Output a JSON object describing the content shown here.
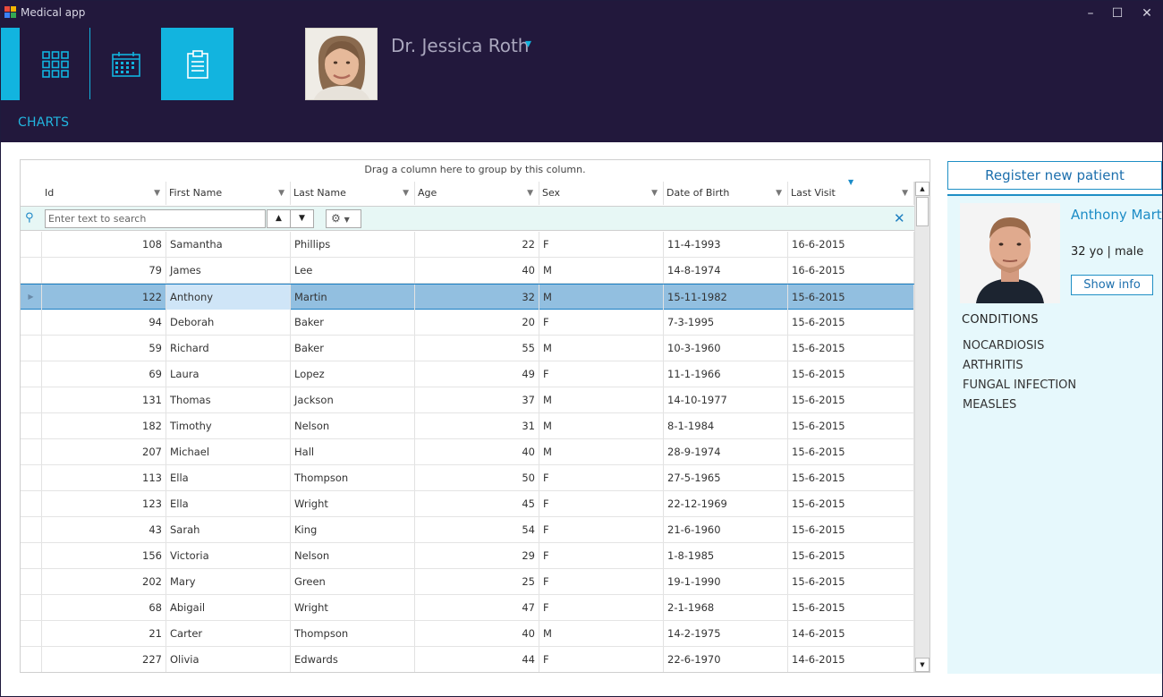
{
  "window": {
    "title": "Medical app"
  },
  "nav": {
    "section_label": "CHARTS",
    "doctor_name": "Dr. Jessica Roth"
  },
  "grid": {
    "group_panel_text": "Drag a column here to group by this column.",
    "columns": [
      "Id",
      "First Name",
      "Last Name",
      "Age",
      "Sex",
      "Date of Birth",
      "Last Visit"
    ],
    "search_placeholder": "Enter text to search",
    "rows": [
      {
        "id": "108",
        "first": "Samantha",
        "last": "Phillips",
        "age": "22",
        "sex": "F",
        "dob": "11-4-1993",
        "visit": "16-6-2015"
      },
      {
        "id": "79",
        "first": "James",
        "last": "Lee",
        "age": "40",
        "sex": "M",
        "dob": "14-8-1974",
        "visit": "16-6-2015"
      },
      {
        "id": "122",
        "first": "Anthony",
        "last": "Martin",
        "age": "32",
        "sex": "M",
        "dob": "15-11-1982",
        "visit": "15-6-2015"
      },
      {
        "id": "94",
        "first": "Deborah",
        "last": "Baker",
        "age": "20",
        "sex": "F",
        "dob": "7-3-1995",
        "visit": "15-6-2015"
      },
      {
        "id": "59",
        "first": "Richard",
        "last": "Baker",
        "age": "55",
        "sex": "M",
        "dob": "10-3-1960",
        "visit": "15-6-2015"
      },
      {
        "id": "69",
        "first": "Laura",
        "last": "Lopez",
        "age": "49",
        "sex": "F",
        "dob": "11-1-1966",
        "visit": "15-6-2015"
      },
      {
        "id": "131",
        "first": "Thomas",
        "last": "Jackson",
        "age": "37",
        "sex": "M",
        "dob": "14-10-1977",
        "visit": "15-6-2015"
      },
      {
        "id": "182",
        "first": "Timothy",
        "last": "Nelson",
        "age": "31",
        "sex": "M",
        "dob": "8-1-1984",
        "visit": "15-6-2015"
      },
      {
        "id": "207",
        "first": "Michael",
        "last": "Hall",
        "age": "40",
        "sex": "M",
        "dob": "28-9-1974",
        "visit": "15-6-2015"
      },
      {
        "id": "113",
        "first": "Ella",
        "last": "Thompson",
        "age": "50",
        "sex": "F",
        "dob": "27-5-1965",
        "visit": "15-6-2015"
      },
      {
        "id": "123",
        "first": "Ella",
        "last": "Wright",
        "age": "45",
        "sex": "F",
        "dob": "22-12-1969",
        "visit": "15-6-2015"
      },
      {
        "id": "43",
        "first": "Sarah",
        "last": "King",
        "age": "54",
        "sex": "F",
        "dob": "21-6-1960",
        "visit": "15-6-2015"
      },
      {
        "id": "156",
        "first": "Victoria",
        "last": "Nelson",
        "age": "29",
        "sex": "F",
        "dob": "1-8-1985",
        "visit": "15-6-2015"
      },
      {
        "id": "202",
        "first": "Mary",
        "last": "Green",
        "age": "25",
        "sex": "F",
        "dob": "19-1-1990",
        "visit": "15-6-2015"
      },
      {
        "id": "68",
        "first": "Abigail",
        "last": "Wright",
        "age": "47",
        "sex": "F",
        "dob": "2-1-1968",
        "visit": "15-6-2015"
      },
      {
        "id": "21",
        "first": "Carter",
        "last": "Thompson",
        "age": "40",
        "sex": "M",
        "dob": "14-2-1975",
        "visit": "14-6-2015"
      },
      {
        "id": "227",
        "first": "Olivia",
        "last": "Edwards",
        "age": "44",
        "sex": "F",
        "dob": "22-6-1970",
        "visit": "14-6-2015"
      }
    ],
    "selected_row_index": 2
  },
  "patient": {
    "register_label": "Register new patient",
    "name": "Anthony Martin",
    "meta": "32 yo | male",
    "show_info_label": "Show info",
    "conditions_title": "CONDITIONS",
    "conditions": [
      "NOCARDIOSIS",
      "ARTHRITIS",
      "FUNGAL INFECTION",
      "MEASLES"
    ]
  },
  "colors": {
    "accent": "#12b4df",
    "header_bg": "#22183c",
    "selected_row": "#92bfe0",
    "panel_bg": "#e6f8fc"
  }
}
